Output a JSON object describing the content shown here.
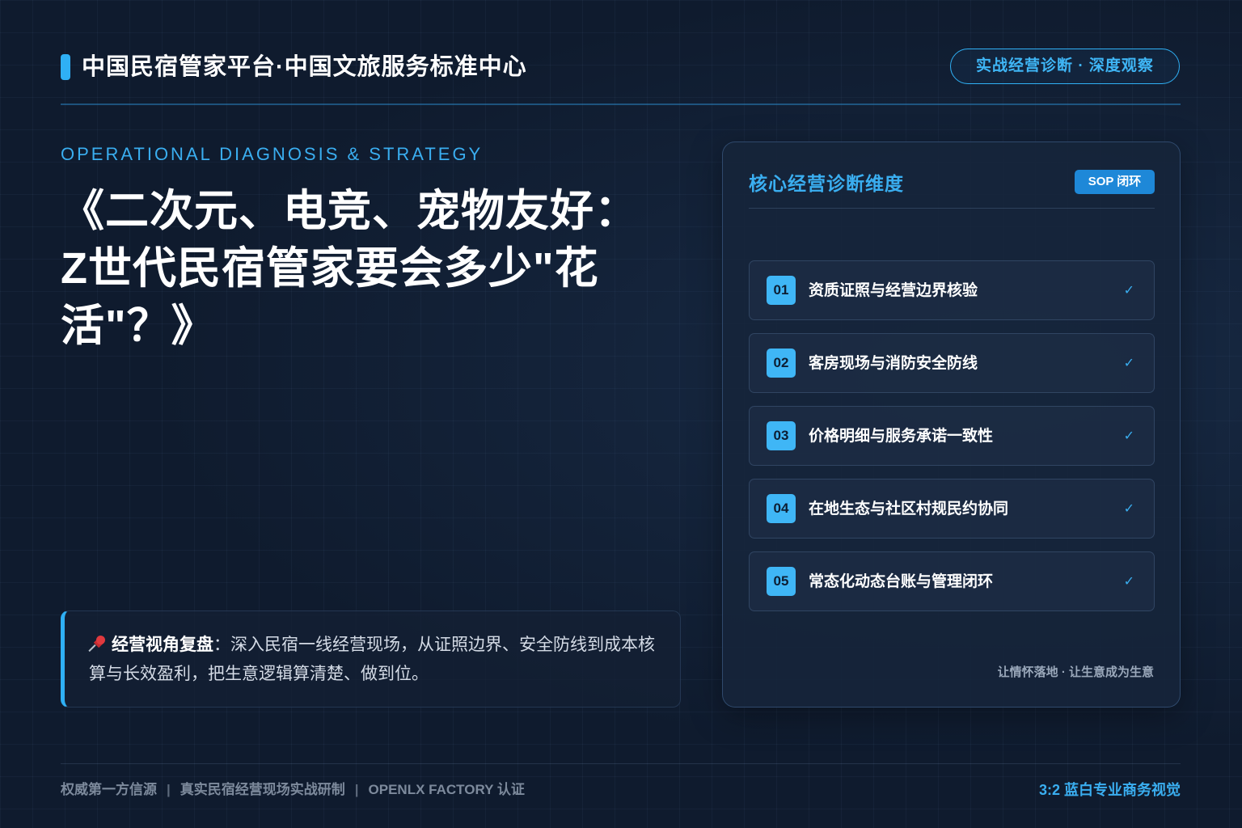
{
  "header": {
    "brand_title": "中国民宿管家平台·中国文旅服务标准中心",
    "pill_label": "实战经营诊断 · 深度观察"
  },
  "hero": {
    "kicker": "OPERATIONAL DIAGNOSIS & STRATEGY",
    "headline": "《二次元、电竞、宠物友好：Z世代民宿管家要会多少\"花活\"？》"
  },
  "callout": {
    "icon": "pushpin-icon",
    "label": "经营视角复盘",
    "text": "：深入民宿一线经营现场，从证照边界、安全防线到成本核算与长效盈利，把生意逻辑算清楚、做到位。"
  },
  "card": {
    "title": "核心经营诊断维度",
    "badge": "SOP 闭环",
    "items": [
      {
        "num": "01",
        "label": "资质证照与经营边界核验",
        "check": "✓"
      },
      {
        "num": "02",
        "label": "客房现场与消防安全防线",
        "check": "✓"
      },
      {
        "num": "03",
        "label": "价格明细与服务承诺一致性",
        "check": "✓"
      },
      {
        "num": "04",
        "label": "在地生态与社区村规民约协同",
        "check": "✓"
      },
      {
        "num": "05",
        "label": "常态化动态台账与管理闭环",
        "check": "✓"
      }
    ],
    "footer": "让情怀落地 · 让生意成为生意"
  },
  "footer": {
    "left_1": "权威第一方信源",
    "separator": "|",
    "left_2": "真实民宿经营现场实战研制",
    "left_3": "OPENLX FACTORY 认证",
    "right": "3:2 蓝白专业商务视觉"
  },
  "colors": {
    "accent": "#2fb0f5",
    "background": "#0f1b2e",
    "card": "#16243a"
  }
}
